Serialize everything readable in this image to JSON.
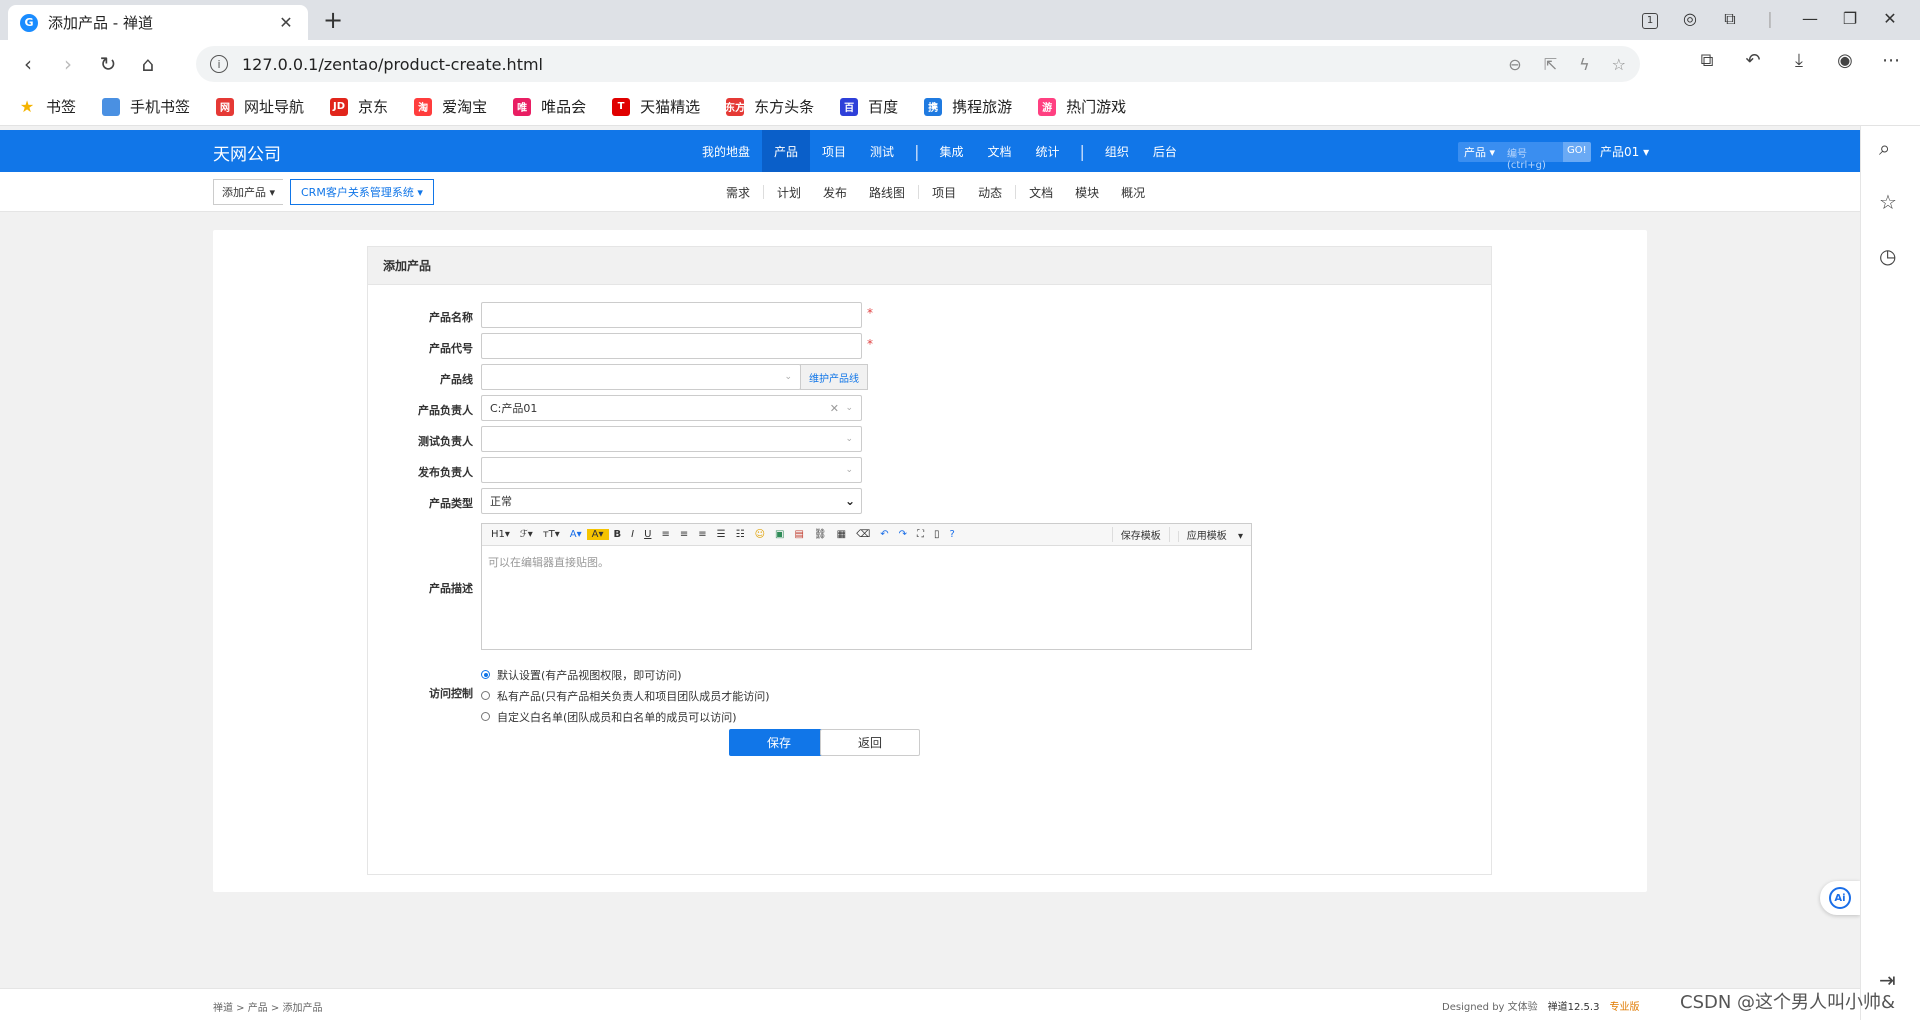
{
  "browser": {
    "tab_title": "添加产品 - 禅道",
    "favicon_letter": "G",
    "url": "127.0.0.1/zentao/product-create.html",
    "tab_count_badge": "1"
  },
  "bookmarks": [
    {
      "label": "书签",
      "color": "#f5b400",
      "glyph": "★"
    },
    {
      "label": "手机书签",
      "color": "#4a90e2",
      "glyph": ""
    },
    {
      "label": "网址导航",
      "color": "#e53935",
      "glyph": "网"
    },
    {
      "label": "京东",
      "color": "#e1251b",
      "glyph": "JD"
    },
    {
      "label": "爱淘宝",
      "color": "#ff3d3d",
      "glyph": "淘"
    },
    {
      "label": "唯品会",
      "color": "#e91e63",
      "glyph": "唯"
    },
    {
      "label": "天猫精选",
      "color": "#e00000",
      "glyph": "T"
    },
    {
      "label": "东方头条",
      "color": "#e53935",
      "glyph": "东方"
    },
    {
      "label": "百度",
      "color": "#2e3fd9",
      "glyph": "百"
    },
    {
      "label": "携程旅游",
      "color": "#1f7ae0",
      "glyph": "携"
    },
    {
      "label": "热门游戏",
      "color": "#ff4081",
      "glyph": "游"
    }
  ],
  "app": {
    "brand": "天网公司",
    "nav": [
      "我的地盘",
      "产品",
      "项目",
      "测试",
      "集成",
      "文档",
      "统计",
      "组织",
      "后台"
    ],
    "search_scope": "产品",
    "search_placeholder": "编号(ctrl+g)",
    "search_go": "GO!",
    "user": "产品01"
  },
  "subbar": {
    "crumb_current": "添加产品",
    "crumb_product": "CRM客户关系管理系统",
    "subnav": [
      "需求",
      "计划",
      "发布",
      "路线图",
      "项目",
      "动态",
      "文档",
      "模块",
      "概况"
    ]
  },
  "form": {
    "title": "添加产品",
    "labels": {
      "name": "产品名称",
      "code": "产品代号",
      "line": "产品线",
      "po": "产品负责人",
      "qd": "测试负责人",
      "rd": "发布负责人",
      "type": "产品类型",
      "desc": "产品描述",
      "acl": "访问控制"
    },
    "required_mark": "*",
    "maintain_line_button": "维护产品线",
    "po_value": "C:产品01",
    "type_value": "正常",
    "type_options": [
      "正常"
    ],
    "editor": {
      "toolbar": [
        "H1",
        "ℱ",
        "тT",
        "A",
        "A",
        "B",
        "I",
        "U"
      ],
      "save_template": "保存模板",
      "apply_template": "应用模板",
      "placeholder": "可以在编辑器直接贴图。"
    },
    "acl_options": [
      {
        "label": "默认设置(有产品视图权限，即可访问)",
        "checked": true
      },
      {
        "label": "私有产品(只有产品相关负责人和项目团队成员才能访问)",
        "checked": false
      },
      {
        "label": "自定义白名单(团队成员和白名单的成员可以访问)",
        "checked": false
      }
    ],
    "save_button": "保存",
    "back_button": "返回"
  },
  "ai_button": "Ai",
  "footer": {
    "breadcrumb": "禅道 > 产品 > 添加产品",
    "designed_by": "Designed by 文体验",
    "version": "禅道12.5.3",
    "edition": "专业版"
  },
  "watermark": "CSDN @这个男人叫小帅&"
}
